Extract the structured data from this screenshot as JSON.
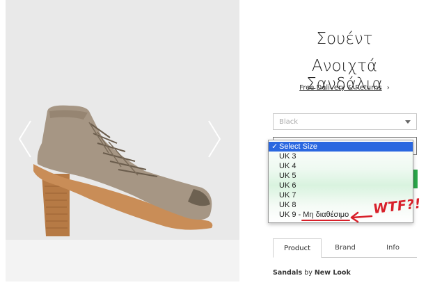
{
  "product": {
    "title_line1": "Σουέντ",
    "title_line2": "Ανοιχτά Σανδάλια",
    "delivery_link": "Free Delivery & Returns",
    "delivery_chevron": "›"
  },
  "colour_select": {
    "value": "Black"
  },
  "size_select": {
    "options": [
      {
        "label": "Select Size",
        "selected": true,
        "check": "✓"
      },
      {
        "label": "UK 3"
      },
      {
        "label": "UK 4"
      },
      {
        "label": "UK 5"
      },
      {
        "label": "UK 6"
      },
      {
        "label": "UK 7"
      },
      {
        "label": "UK 8"
      },
      {
        "label": "UK 9 - ",
        "unavailable_text": "Μη διαθέσιμο"
      }
    ]
  },
  "annotation": {
    "text": "WTF?!"
  },
  "tabs": [
    {
      "label": "Product",
      "active": true
    },
    {
      "label": "Brand"
    },
    {
      "label": "Info"
    }
  ],
  "byline": {
    "category": "Sandals",
    "by": "by",
    "brand": "New Look"
  },
  "icons": {
    "prev": "chevron-left-icon",
    "next": "chevron-right-icon",
    "dropdown": "caret-down-icon",
    "check": "checkmark-icon",
    "annotation_arrow": "arrow-left-icon"
  },
  "colors": {
    "accent_green": "#2aa84a",
    "select_highlight": "#2a67e0",
    "annotation_red": "#d8202a"
  }
}
